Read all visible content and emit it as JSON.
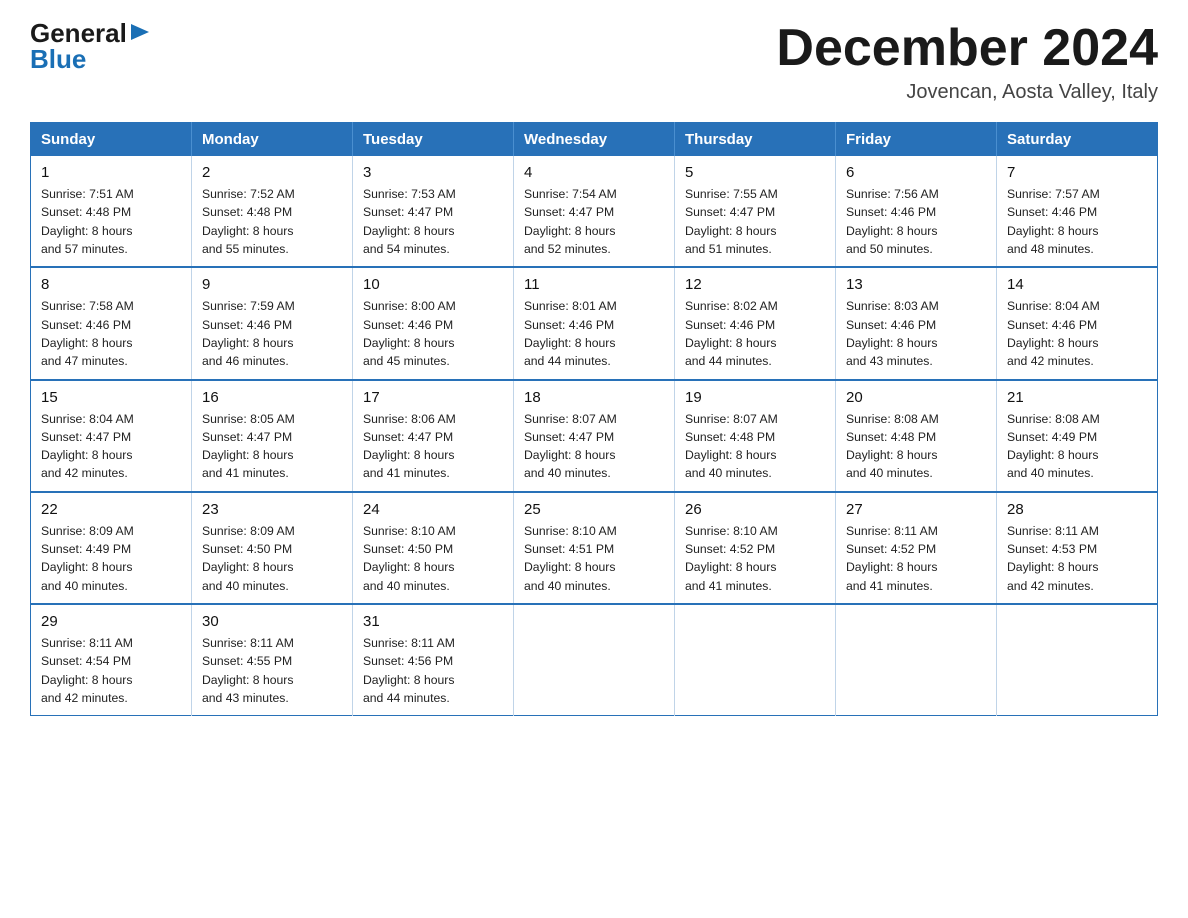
{
  "header": {
    "logo_general": "General",
    "logo_blue": "Blue",
    "month_title": "December 2024",
    "location": "Jovencan, Aosta Valley, Italy"
  },
  "days_of_week": [
    "Sunday",
    "Monday",
    "Tuesday",
    "Wednesday",
    "Thursday",
    "Friday",
    "Saturday"
  ],
  "weeks": [
    [
      {
        "day": "1",
        "sunrise": "7:51 AM",
        "sunset": "4:48 PM",
        "daylight": "8 hours and 57 minutes."
      },
      {
        "day": "2",
        "sunrise": "7:52 AM",
        "sunset": "4:48 PM",
        "daylight": "8 hours and 55 minutes."
      },
      {
        "day": "3",
        "sunrise": "7:53 AM",
        "sunset": "4:47 PM",
        "daylight": "8 hours and 54 minutes."
      },
      {
        "day": "4",
        "sunrise": "7:54 AM",
        "sunset": "4:47 PM",
        "daylight": "8 hours and 52 minutes."
      },
      {
        "day": "5",
        "sunrise": "7:55 AM",
        "sunset": "4:47 PM",
        "daylight": "8 hours and 51 minutes."
      },
      {
        "day": "6",
        "sunrise": "7:56 AM",
        "sunset": "4:46 PM",
        "daylight": "8 hours and 50 minutes."
      },
      {
        "day": "7",
        "sunrise": "7:57 AM",
        "sunset": "4:46 PM",
        "daylight": "8 hours and 48 minutes."
      }
    ],
    [
      {
        "day": "8",
        "sunrise": "7:58 AM",
        "sunset": "4:46 PM",
        "daylight": "8 hours and 47 minutes."
      },
      {
        "day": "9",
        "sunrise": "7:59 AM",
        "sunset": "4:46 PM",
        "daylight": "8 hours and 46 minutes."
      },
      {
        "day": "10",
        "sunrise": "8:00 AM",
        "sunset": "4:46 PM",
        "daylight": "8 hours and 45 minutes."
      },
      {
        "day": "11",
        "sunrise": "8:01 AM",
        "sunset": "4:46 PM",
        "daylight": "8 hours and 44 minutes."
      },
      {
        "day": "12",
        "sunrise": "8:02 AM",
        "sunset": "4:46 PM",
        "daylight": "8 hours and 44 minutes."
      },
      {
        "day": "13",
        "sunrise": "8:03 AM",
        "sunset": "4:46 PM",
        "daylight": "8 hours and 43 minutes."
      },
      {
        "day": "14",
        "sunrise": "8:04 AM",
        "sunset": "4:46 PM",
        "daylight": "8 hours and 42 minutes."
      }
    ],
    [
      {
        "day": "15",
        "sunrise": "8:04 AM",
        "sunset": "4:47 PM",
        "daylight": "8 hours and 42 minutes."
      },
      {
        "day": "16",
        "sunrise": "8:05 AM",
        "sunset": "4:47 PM",
        "daylight": "8 hours and 41 minutes."
      },
      {
        "day": "17",
        "sunrise": "8:06 AM",
        "sunset": "4:47 PM",
        "daylight": "8 hours and 41 minutes."
      },
      {
        "day": "18",
        "sunrise": "8:07 AM",
        "sunset": "4:47 PM",
        "daylight": "8 hours and 40 minutes."
      },
      {
        "day": "19",
        "sunrise": "8:07 AM",
        "sunset": "4:48 PM",
        "daylight": "8 hours and 40 minutes."
      },
      {
        "day": "20",
        "sunrise": "8:08 AM",
        "sunset": "4:48 PM",
        "daylight": "8 hours and 40 minutes."
      },
      {
        "day": "21",
        "sunrise": "8:08 AM",
        "sunset": "4:49 PM",
        "daylight": "8 hours and 40 minutes."
      }
    ],
    [
      {
        "day": "22",
        "sunrise": "8:09 AM",
        "sunset": "4:49 PM",
        "daylight": "8 hours and 40 minutes."
      },
      {
        "day": "23",
        "sunrise": "8:09 AM",
        "sunset": "4:50 PM",
        "daylight": "8 hours and 40 minutes."
      },
      {
        "day": "24",
        "sunrise": "8:10 AM",
        "sunset": "4:50 PM",
        "daylight": "8 hours and 40 minutes."
      },
      {
        "day": "25",
        "sunrise": "8:10 AM",
        "sunset": "4:51 PM",
        "daylight": "8 hours and 40 minutes."
      },
      {
        "day": "26",
        "sunrise": "8:10 AM",
        "sunset": "4:52 PM",
        "daylight": "8 hours and 41 minutes."
      },
      {
        "day": "27",
        "sunrise": "8:11 AM",
        "sunset": "4:52 PM",
        "daylight": "8 hours and 41 minutes."
      },
      {
        "day": "28",
        "sunrise": "8:11 AM",
        "sunset": "4:53 PM",
        "daylight": "8 hours and 42 minutes."
      }
    ],
    [
      {
        "day": "29",
        "sunrise": "8:11 AM",
        "sunset": "4:54 PM",
        "daylight": "8 hours and 42 minutes."
      },
      {
        "day": "30",
        "sunrise": "8:11 AM",
        "sunset": "4:55 PM",
        "daylight": "8 hours and 43 minutes."
      },
      {
        "day": "31",
        "sunrise": "8:11 AM",
        "sunset": "4:56 PM",
        "daylight": "8 hours and 44 minutes."
      },
      null,
      null,
      null,
      null
    ]
  ],
  "labels": {
    "sunrise": "Sunrise:",
    "sunset": "Sunset:",
    "daylight": "Daylight:"
  }
}
